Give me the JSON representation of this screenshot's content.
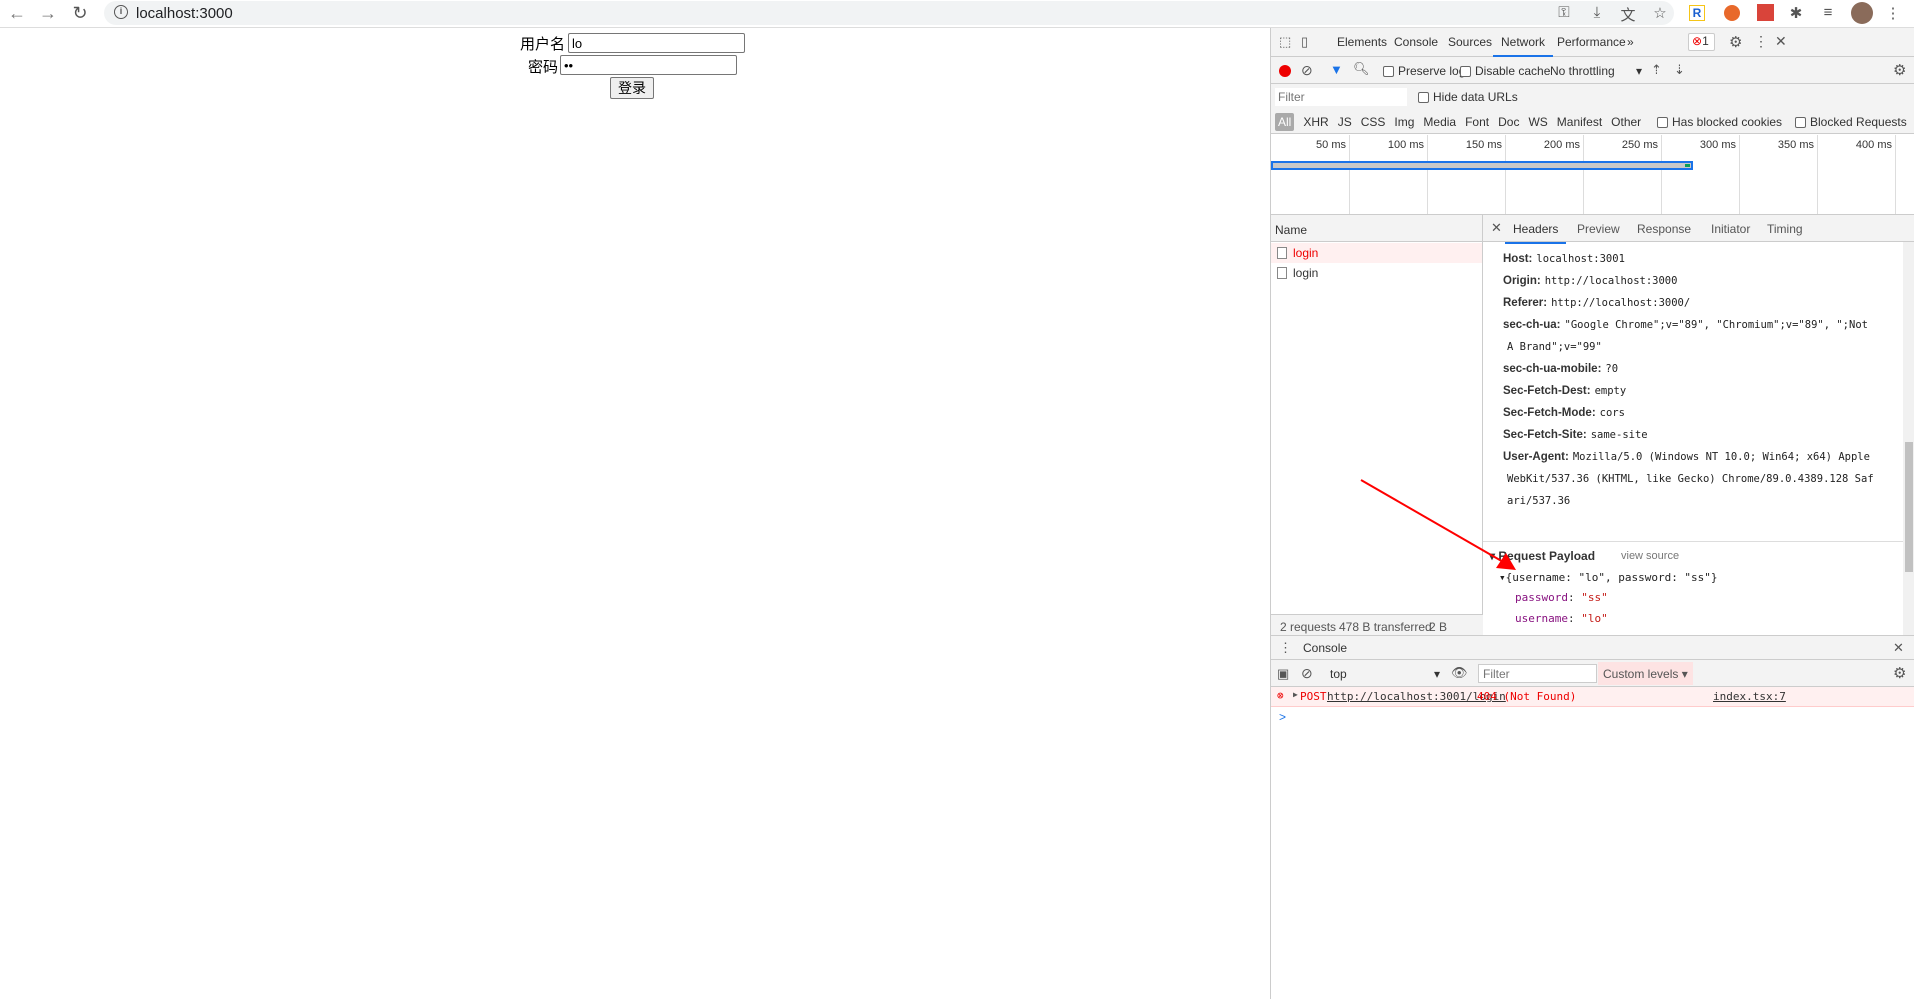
{
  "browser": {
    "url": "localhost:3000",
    "toolbar_icons": [
      "key-icon",
      "install-icon",
      "translate-icon",
      "star-icon",
      "extension-r-icon",
      "extension-brush-icon",
      "extension-paw-icon",
      "puzzle-icon",
      "media-icon",
      "avatar",
      "menu-icon"
    ]
  },
  "page": {
    "username_label": "用户名",
    "username_value": "lo",
    "password_label": "密码",
    "password_value": "ss",
    "login_button": "登录"
  },
  "devtools": {
    "tabs": [
      "Elements",
      "Console",
      "Sources",
      "Network",
      "Performance"
    ],
    "active_tab": "Network",
    "more": "»",
    "error_count": "1",
    "toolbar": {
      "preserve_log": "Preserve log",
      "disable_cache": "Disable cache",
      "throttling": "No throttling"
    },
    "filter": {
      "placeholder": "Filter",
      "hide_data_urls": "Hide data URLs"
    },
    "types": [
      "All",
      "XHR",
      "JS",
      "CSS",
      "Img",
      "Media",
      "Font",
      "Doc",
      "WS",
      "Manifest",
      "Other"
    ],
    "has_blocked_cookies": "Has blocked cookies",
    "blocked_requests": "Blocked Requests",
    "timeline_ticks": [
      "50 ms",
      "100 ms",
      "150 ms",
      "200 ms",
      "250 ms",
      "300 ms",
      "350 ms",
      "400 ms"
    ],
    "name_header": "Name",
    "requests": [
      {
        "name": "login",
        "error": true
      },
      {
        "name": "login",
        "error": false
      }
    ],
    "detail_tabs": [
      "Headers",
      "Preview",
      "Response",
      "Initiator",
      "Timing"
    ],
    "headers": [
      {
        "k": "Host:",
        "v": "localhost:3001"
      },
      {
        "k": "Origin:",
        "v": "http://localhost:3000"
      },
      {
        "k": "Referer:",
        "v": "http://localhost:3000/"
      },
      {
        "k": "sec-ch-ua:",
        "v": "\"Google Chrome\";v=\"89\", \"Chromium\";v=\"89\", \";Not"
      },
      {
        "k": "",
        "v": "A Brand\";v=\"99\""
      },
      {
        "k": "sec-ch-ua-mobile:",
        "v": "?0"
      },
      {
        "k": "Sec-Fetch-Dest:",
        "v": "empty"
      },
      {
        "k": "Sec-Fetch-Mode:",
        "v": "cors"
      },
      {
        "k": "Sec-Fetch-Site:",
        "v": "same-site"
      },
      {
        "k": "User-Agent:",
        "v": "Mozilla/5.0 (Windows NT 10.0; Win64; x64) Apple"
      },
      {
        "k": "",
        "v": "WebKit/537.36 (KHTML, like Gecko) Chrome/89.0.4389.128 Saf"
      },
      {
        "k": "",
        "v": "ari/537.36"
      }
    ],
    "payload": {
      "title": "Request Payload",
      "view_source": "view source",
      "summary": "{username: \"lo\", password: \"ss\"}",
      "password_key": "password",
      "password_val": "\"ss\"",
      "username_key": "username",
      "username_val": "\"lo\""
    },
    "status": {
      "requests": "2 requests",
      "transferred": "478 B transferred",
      "resources": "2 B"
    },
    "console": {
      "tab": "Console",
      "context": "top",
      "filter_placeholder": "Filter",
      "levels": "Custom levels ▾",
      "error_method": "POST",
      "error_url": "http://localhost:3001/login",
      "error_status": "404 (Not Found)",
      "error_source": "index.tsx:7",
      "prompt": ">"
    }
  },
  "colors": {
    "accent": "#1a73e8",
    "error": "#e00",
    "annotation_arrow": "#ff0000"
  }
}
